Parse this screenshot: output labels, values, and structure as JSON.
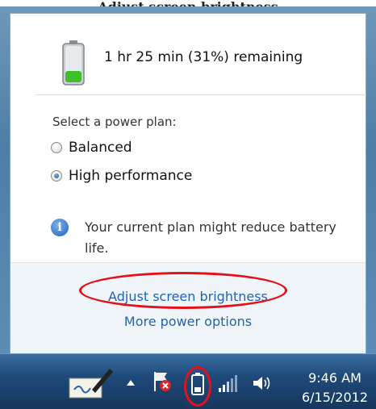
{
  "header": {
    "title": "... Adjust screen brightness ..."
  },
  "battery": {
    "status": "1 hr 25 min (31%) remaining",
    "percent": 31
  },
  "power_plans": {
    "heading": "Select a power plan:",
    "plans": [
      {
        "label": "Balanced",
        "selected": false
      },
      {
        "label": "High performance",
        "selected": true
      }
    ]
  },
  "info": {
    "message": "Your current plan might reduce battery life."
  },
  "links": {
    "adjust_brightness": "Adjust screen brightness",
    "more_options": "More power options"
  },
  "taskbar": {
    "time": "9:46 AM",
    "date": "6/15/2012",
    "icons": [
      "pen-input-icon",
      "show-hidden-icons-arrow",
      "action-center-flag-icon",
      "battery-icon",
      "signal-bars-icon",
      "volume-icon"
    ]
  },
  "colors": {
    "link": "#1f63b6",
    "highlight": "#e4101a",
    "battery_fill": "#3fbf2a"
  }
}
